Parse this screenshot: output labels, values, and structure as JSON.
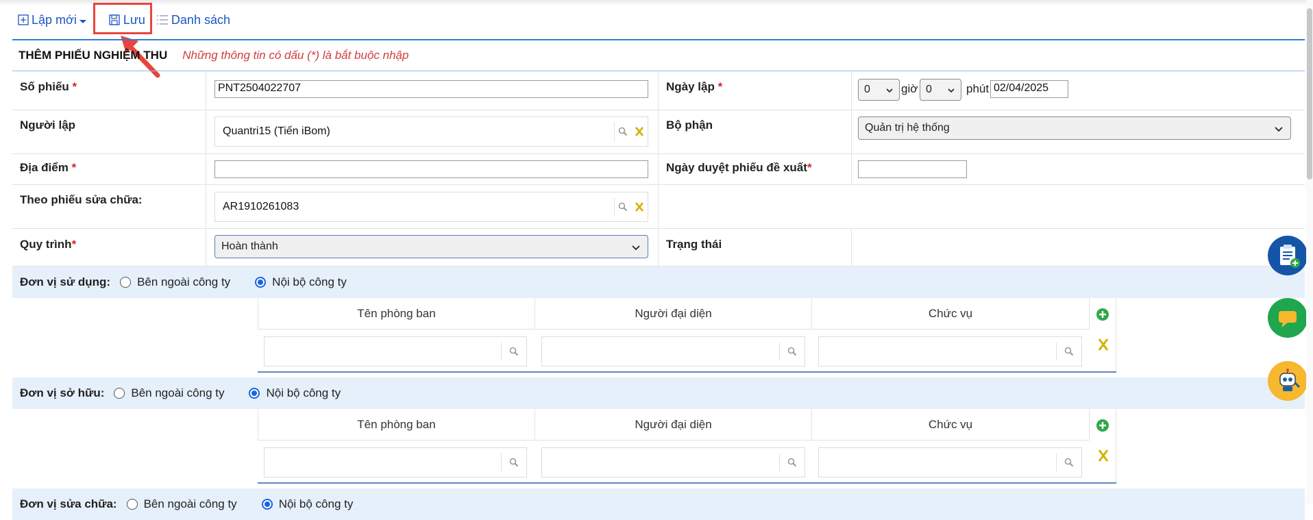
{
  "toolbar": {
    "new_label": "Lập mới",
    "save_label": "Lưu",
    "list_label": "Danh sách"
  },
  "form": {
    "title": "THÊM PHIẾU NGHIỆM THU",
    "hint": "Những thông tin có dấu (*) là bắt buộc nhập",
    "required_mark": "*",
    "so_phieu": {
      "label": "Số phiếu",
      "value": "PNT2504022707"
    },
    "ngay_lap": {
      "label": "Ngày lập",
      "hour": "0",
      "hour_unit": "giờ",
      "minute": "0",
      "minute_unit": "phút",
      "date": "02/04/2025"
    },
    "nguoi_lap": {
      "label": "Người lập",
      "value": "Quantri15 (Tiến iBom)"
    },
    "bo_phan": {
      "label": "Bộ phận",
      "value": "Quản trị hệ thống"
    },
    "dia_diem": {
      "label": "Địa điểm",
      "value": ""
    },
    "ngay_duyet": {
      "label": "Ngày duyệt phiếu đề xuất",
      "value": ""
    },
    "theo_phieu": {
      "label": "Theo phiếu sửa chữa:",
      "value": "AR1910261083"
    },
    "quy_trinh": {
      "label": "Quy trình",
      "value": "Hoàn thành"
    },
    "trang_thai": {
      "label": "Trạng thái"
    }
  },
  "sections": {
    "don_vi_su_dung": {
      "label": "Đơn vị sử dụng:",
      "option_external": "Bên ngoài công ty",
      "option_internal": "Nội bộ công ty",
      "selected": "internal"
    },
    "don_vi_so_huu": {
      "label": "Đơn vị sở hữu:",
      "option_external": "Bên ngoài công ty",
      "option_internal": "Nội bộ công ty",
      "selected": "internal"
    },
    "don_vi_sua_chua": {
      "label": "Đơn vị sửa chữa:",
      "option_external": "Bên ngoài công ty",
      "option_internal": "Nội bộ công ty",
      "selected": "internal"
    }
  },
  "subtable": {
    "col_department": "Tên phòng ban",
    "col_representative": "Người đại diện",
    "col_position": "Chức vụ"
  },
  "colors": {
    "link_blue": "#1a55c4",
    "required_red": "#d22222",
    "band_blue": "#e5f0fa",
    "highlight_red": "#e8453c"
  }
}
